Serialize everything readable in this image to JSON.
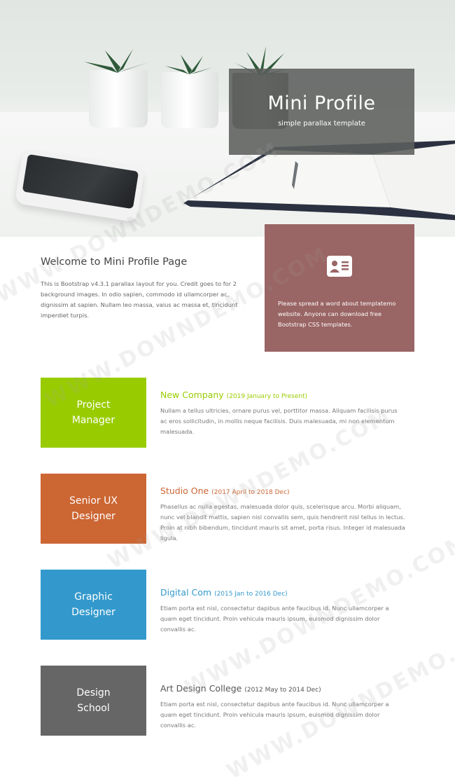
{
  "header": {
    "title": "Mini Profile",
    "subtitle": "simple parallax template"
  },
  "welcome": {
    "heading": "Welcome to Mini Profile Page",
    "body": "This is Bootstrap v4.3.1 parallax layout for you. Credit goes to for 2 background images. In odio sapien, commodo id ullamcorper ac, dignissim at sapien. Nullam leo massa, vaius ac massa et, tincidunt imperdiet turpis."
  },
  "share": {
    "icon": "contact-card-icon",
    "text": "Please spread a word about templatemo website. Anyone can download free Bootstrap CSS templates."
  },
  "timeline": [
    {
      "role": "Project Manager",
      "company": "New Company",
      "period": "(2019 January to Present)",
      "description": "Nullam a tellus ultricies, ornare purus vel, porttitor massa. Aliquam facilisis purus ac eros sollicitudin, in mollis neque facilisis. Duis malesuada, mi non elementum malesuada.",
      "color": "#99cc00"
    },
    {
      "role": "Senior UX Designer",
      "company": "Studio One",
      "period": "(2017 April to 2018 Dec)",
      "description": "Phasellus ac nulla egestas, malesuada dolor quis, scelerisque arcu. Morbi aliquam, nunc vel blandit mattis, sapien nisl convallis sem, quis hendrerit nisl tellus in lectus. Proin at nibh bibendum, tincidunt mauris sit amet, porta risus. Integer id malesuada ligula.",
      "color": "#cc6633"
    },
    {
      "role": "Graphic Designer",
      "company": "Digital Com",
      "period": "(2015 Jan to 2016 Dec)",
      "description": "Etiam porta est nisl, consectetur dapibus ante faucibus id. Nunc ullamcorper a quam eget tincidunt. Proin vehicula mauris ipsum, euismod dignissim dolor convallis ac.",
      "color": "#3399cc"
    },
    {
      "role": "Design School",
      "company": "Art Design College",
      "period": "(2012 May to 2014 Dec)",
      "description": "Etiam porta est nisl, consectetur dapibus ante faucibus id. Nunc ullamcorper a quam eget tincidunt. Proin vehicula mauris ipsum, euismod dignissim dolor convallis ac.",
      "color": "#666666"
    }
  ],
  "watermark": "WWW.DOWNDEMO.COM"
}
